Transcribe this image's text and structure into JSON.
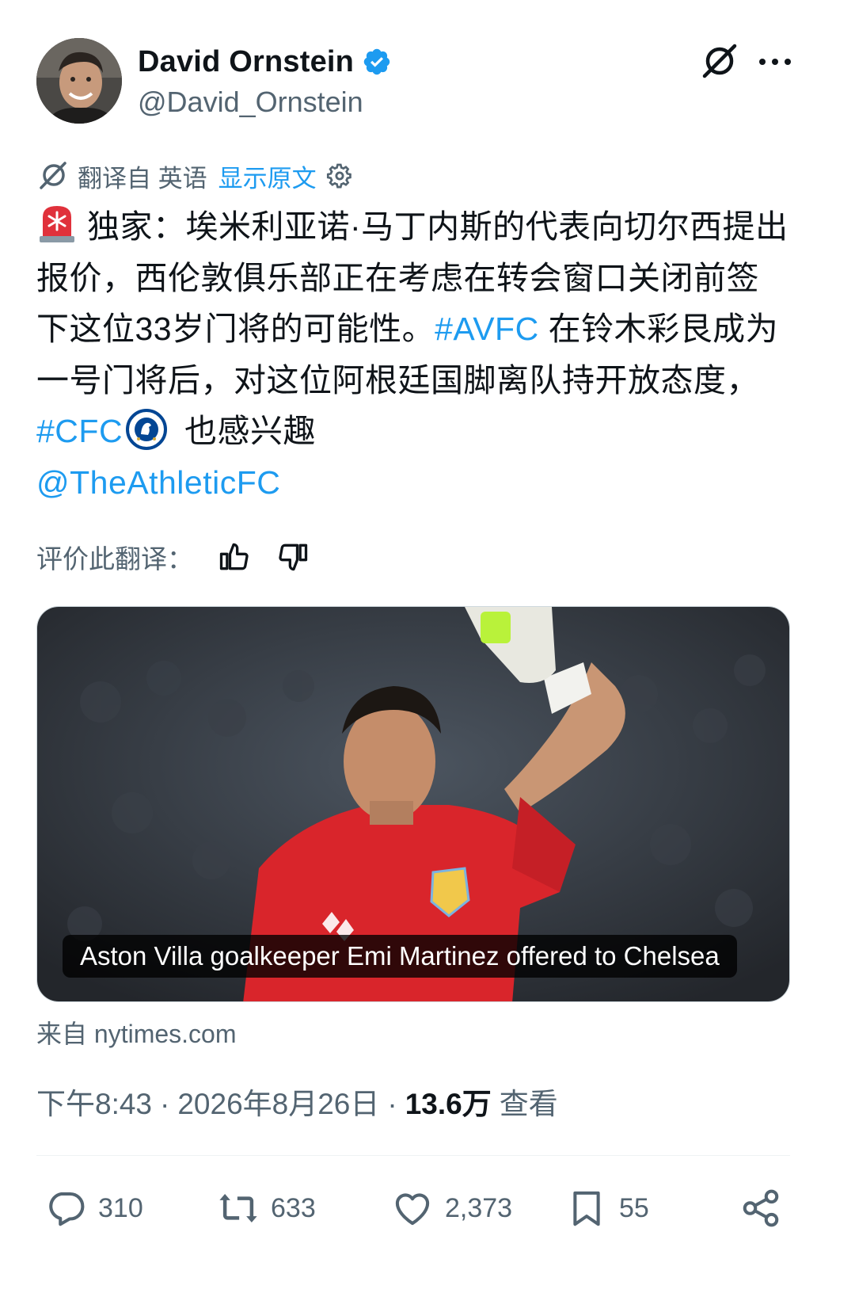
{
  "author": {
    "display_name": "David Ornstein",
    "handle": "@David_Ornstein",
    "verified_icon": "verified-badge-icon"
  },
  "header_actions": {
    "grok_icon": "grok-icon",
    "more_icon": "more-dots-icon"
  },
  "translation": {
    "prefix": "翻译自 英语",
    "show_original": "显示原文",
    "settings_icon": "gear-icon"
  },
  "tweet": {
    "siren_emoji": "rotating-light-emoji",
    "part1": "独家：埃米利亚诺·马丁内斯的代表向切尔西提出报价，西伦敦俱乐部正在考虑在转会窗口关闭前签下这位33岁门将的可能性。",
    "hashtag1": "#AVFC",
    "part2": " 在铃木彩艮成为一号门将后，对这位阿根廷国脚离队持开放态度，",
    "hashtag2": "#CFC",
    "cfc_emoji": "chelsea-badge-emoji",
    "part3": " 也感兴趣",
    "mention": "@TheAthleticFC"
  },
  "rate_translation": {
    "label": "评价此翻译：",
    "thumbs_up_icon": "thumbs-up-icon",
    "thumbs_down_icon": "thumbs-down-icon"
  },
  "link_card": {
    "caption": "Aston Villa goalkeeper Emi Martinez offered to Chelsea",
    "source": "来自 nytimes.com"
  },
  "meta": {
    "time": "下午8:43",
    "date": "2026年8月26日",
    "views_count": "13.6万",
    "views_label": "查看",
    "separator": "·"
  },
  "actions": {
    "replies": "310",
    "reposts": "633",
    "likes": "2,373",
    "bookmarks": "55"
  },
  "colors": {
    "accent": "#1d9bf0",
    "text": "#0f1419",
    "muted": "#536471"
  }
}
